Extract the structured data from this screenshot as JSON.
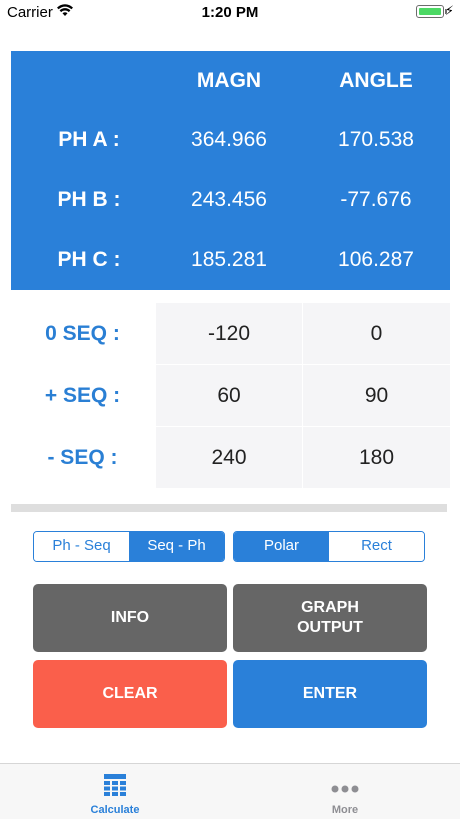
{
  "status_bar": {
    "carrier": "Carrier",
    "time": "1:20 PM",
    "battery_color": "#4cd964",
    "wifi_icon": "wifi-icon",
    "charging_icon": "bolt-icon"
  },
  "phase_table": {
    "headers": [
      "MAGN",
      "ANGLE"
    ],
    "rows": [
      {
        "label": "PH A :",
        "magn": "364.966",
        "angle": "170.538"
      },
      {
        "label": "PH B :",
        "magn": "243.456",
        "angle": "-77.676"
      },
      {
        "label": "PH C :",
        "magn": "185.281",
        "angle": "106.287"
      }
    ],
    "background": "#2a80d9"
  },
  "seq_table": {
    "rows": [
      {
        "label": "0 SEQ :",
        "v1": "-120",
        "v2": "0"
      },
      {
        "label": "+ SEQ :",
        "v1": "60",
        "v2": "90"
      },
      {
        "label": "- SEQ :",
        "v1": "240",
        "v2": "180"
      }
    ]
  },
  "conversion_toggle": {
    "options": [
      "Ph - Seq",
      "Seq - Ph"
    ],
    "selected": "Seq - Ph"
  },
  "format_toggle": {
    "options": [
      "Polar",
      "Rect"
    ],
    "selected": "Polar"
  },
  "buttons": {
    "info": "INFO",
    "graph_output": "GRAPH\nOUTPUT",
    "clear": "CLEAR",
    "enter": "ENTER"
  },
  "tab_bar": {
    "items": [
      {
        "label": "Calculate",
        "icon": "calculator-icon",
        "active": true
      },
      {
        "label": "More",
        "icon": "more-dots-icon",
        "active": false
      }
    ],
    "accent": "#2a80d9"
  }
}
